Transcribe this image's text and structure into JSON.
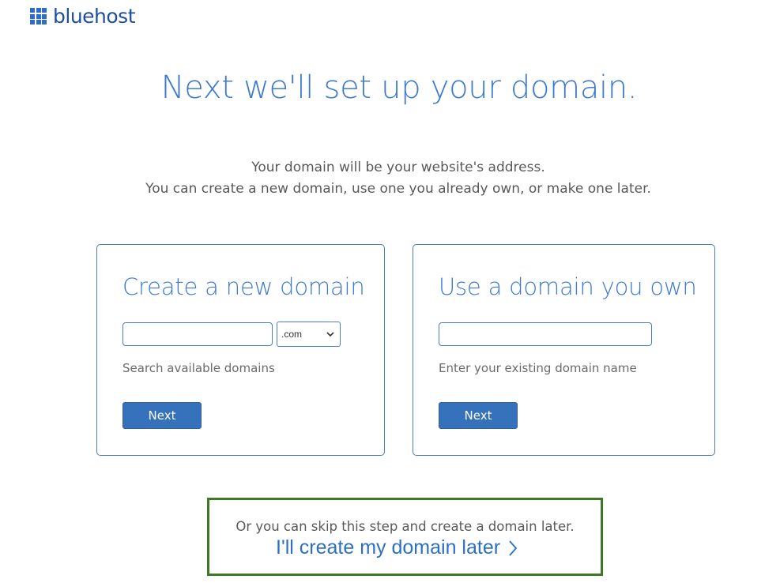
{
  "brand": {
    "name": "bluehost",
    "logo_icon": "grid-logo-icon",
    "accent": "#2f6cc9"
  },
  "heading": "Next we'll set up your domain.",
  "intro": {
    "line1": "Your domain will be your website's address.",
    "line2": "You can create a new domain, use one you already own, or make one later."
  },
  "new_domain": {
    "title": "Create a new domain",
    "input_value": "",
    "tld_selected": ".com",
    "helper": "Search available domains",
    "button_label": "Next"
  },
  "own_domain": {
    "title": "Use a domain you own",
    "input_value": "",
    "helper": "Enter your existing domain name",
    "button_label": "Next"
  },
  "skip": {
    "text": "Or you can skip this step and create a domain later.",
    "link_label": "I'll create my domain later",
    "link_icon": "chevron-right-icon",
    "highlight_color": "#3c7a27"
  },
  "colors": {
    "primary_text": "#3e7ad0",
    "button_bg": "#3572bb",
    "card_border": "#4a7ec8"
  }
}
